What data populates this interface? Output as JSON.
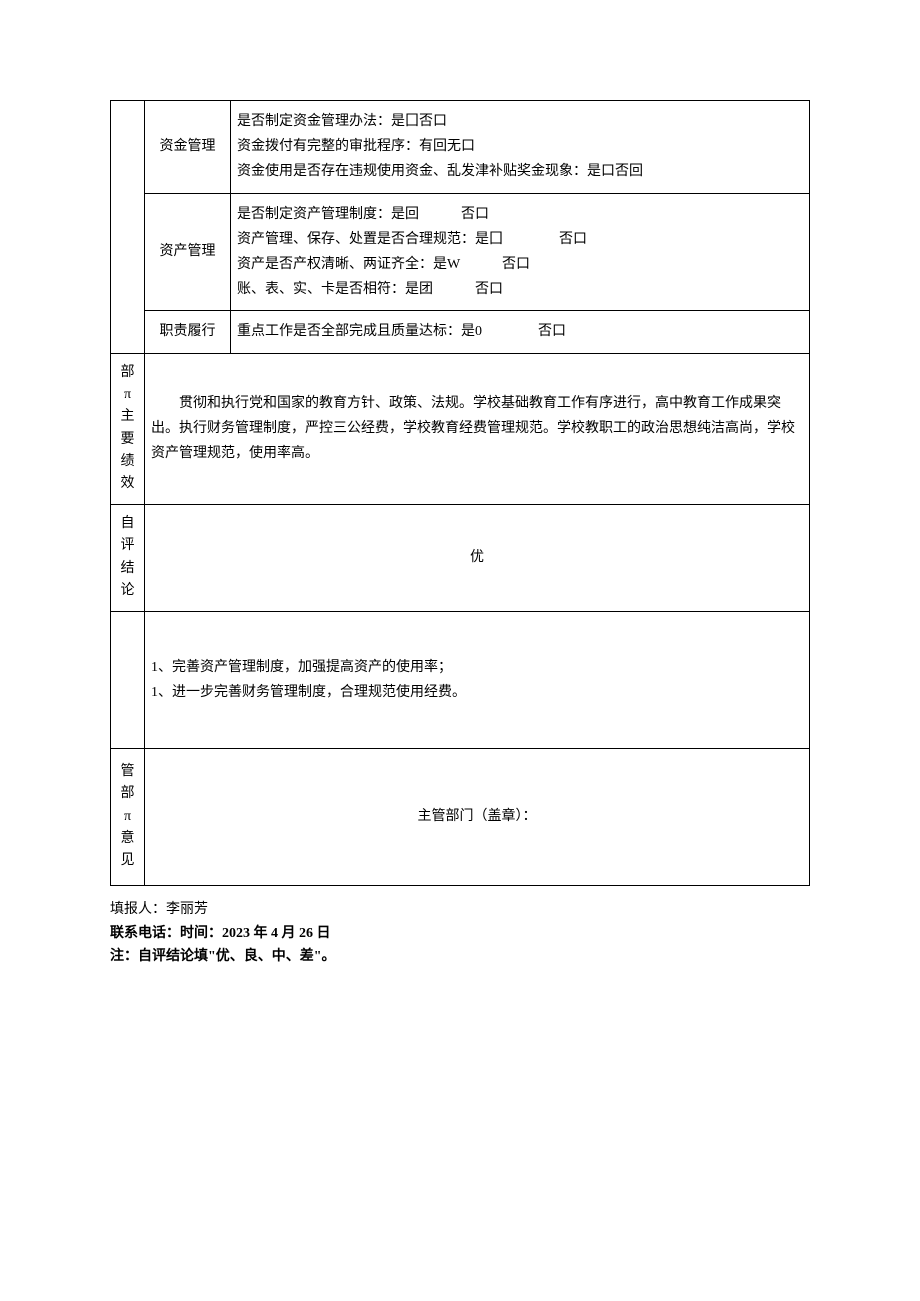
{
  "rows": {
    "funds": {
      "label": "资金管理",
      "line1": "是否制定资金管理办法：是囗否口",
      "line2": "资金拨付有完整的审批程序：有回无口",
      "line3": "资金使用是否存在违规使用资金、乱发津补贴奖金现象：是口否回"
    },
    "assets": {
      "label": "资产管理",
      "line1": "是否制定资产管理制度：是回　　　否口",
      "line2": "资产管理、保存、处置是否合理规范：是囗　　　　否口",
      "line3": "资产是否产权清晰、两证齐全：是W　　　否口",
      "line4": "账、表、实、卡是否相符：是团　　　否口"
    },
    "duty": {
      "label": "职责履行",
      "line1": "重点工作是否全部完成且质量达标：是0　　　　否口"
    }
  },
  "sections": {
    "performance": {
      "label_chars": [
        "部",
        "π",
        "主",
        "要",
        "绩",
        "效"
      ],
      "text": "　　贯彻和执行党和国家的教育方针、政策、法规。学校基础教育工作有序进行，高中教育工作成果突出。执行财务管理制度，严控三公经费，学校教育经费管理规范。学校教职工的政治思想纯洁高尚，学校资产管理规范，使用率高。"
    },
    "self_eval": {
      "label_chars": [
        "自",
        "评",
        "结",
        "论"
      ],
      "value": "优"
    },
    "improve": {
      "line1": "1、完善资产管理制度，加强提高资产的使用率；",
      "line2": "1、进一步完善财务管理制度，合理规范使用经费。"
    },
    "opinion": {
      "label_chars": [
        "管",
        "部",
        "π",
        "意",
        "见"
      ],
      "text": "主管部门（盖章）："
    }
  },
  "footer": {
    "reporter_label": "填报人：",
    "reporter_name": "李丽芳",
    "contact_line": "联系电话：时间：2023 年 4 月 26 日",
    "note": "注：自评结论填\"优、良、中、差\"。"
  }
}
